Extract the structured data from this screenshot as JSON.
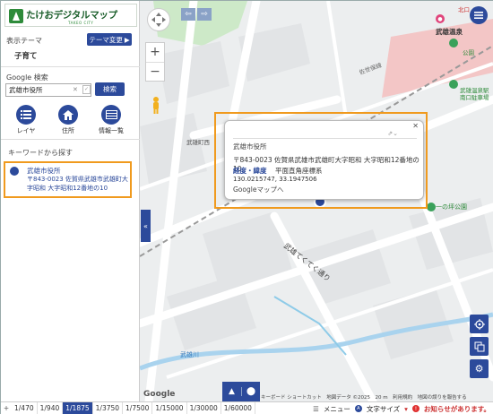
{
  "header": {
    "logo_title": "たけおデジタルマップ",
    "logo_sub": "TAKEO CITY"
  },
  "theme": {
    "label": "表示テーマ",
    "button": "テーマ変更",
    "value": "子育て"
  },
  "search": {
    "label": "Google 検索",
    "value": "武雄市役所",
    "button": "検索"
  },
  "tools": [
    {
      "label": "レイヤ"
    },
    {
      "label": "住所"
    },
    {
      "label": "情報一覧"
    }
  ],
  "keyword_label": "キーワードから探す",
  "result": {
    "name": "武雄市役所",
    "address": "〒843-0023 佐賀県武雄市武雄町大字昭和 大字昭和12番地の10"
  },
  "popup": {
    "title": "武雄市役所",
    "address": "〒843-0023 佐賀県武雄市武雄町大字昭和 大字昭和12番地の10",
    "latlng_label": "経度・緯度",
    "coord_type": "平面直角座標系",
    "coords": "130.0215747, 33.1947506",
    "gmaps_link": "Googleマップへ"
  },
  "map": {
    "labels": {
      "takeo_onsen": "武雄温泉",
      "takeo_onsen_minami": "武雄温泉駅\n南口駐車場",
      "kitaguchi": "北口",
      "koen": "公園",
      "takeo_nishi": "武雄町西",
      "hitotsubo": "一の坪公園",
      "street": "武雄てくてく通り",
      "takeo_river": "武雄川",
      "sakai": "佐世保線",
      "google": "Google",
      "attrib": "キーボード ショートカット　地図データ ©2025　20 m　利用規約　地図の誤りを報告する"
    },
    "zoom_in": "+",
    "zoom_out": "−"
  },
  "bottombar": {
    "plus": "+",
    "scales": [
      "1/470",
      "1/940",
      "1/1875",
      "1/3750",
      "1/7500",
      "1/15000",
      "1/30000",
      "1/60000"
    ],
    "active_scale": "1/1875",
    "menu": "メニュー",
    "font_size": "文字サイズ",
    "notice": "お知らせがあります。"
  }
}
